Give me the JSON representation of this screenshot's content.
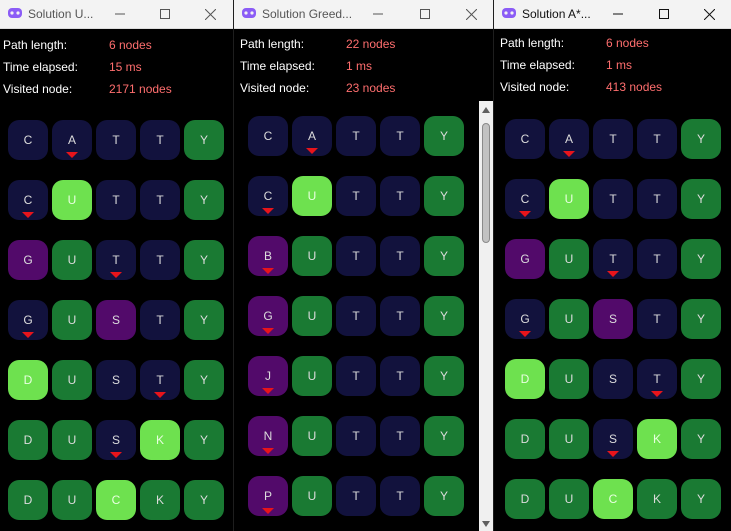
{
  "colors": {
    "navy": "#12123d",
    "green": "#1a7a33",
    "lime": "#6ee14f",
    "purple": "#520a6a",
    "marker": "#e8141b",
    "stat_value": "#ff6e6e"
  },
  "windows": [
    {
      "title": "Solution U...",
      "controls": {
        "minimize": "—",
        "maximize": "☐",
        "close": "✕"
      },
      "stats": [
        {
          "label": "Path length:",
          "value": "6 nodes"
        },
        {
          "label": "Time elapsed:",
          "value": "15 ms"
        },
        {
          "label": "Visited node:",
          "value": "2171 nodes"
        }
      ],
      "rows": [
        [
          {
            "l": "C",
            "c": "navy"
          },
          {
            "l": "A",
            "c": "navy",
            "m": true
          },
          {
            "l": "T",
            "c": "navy"
          },
          {
            "l": "T",
            "c": "navy"
          },
          {
            "l": "Y",
            "c": "green"
          }
        ],
        [
          {
            "l": "C",
            "c": "navy",
            "m": true
          },
          {
            "l": "U",
            "c": "lime"
          },
          {
            "l": "T",
            "c": "navy"
          },
          {
            "l": "T",
            "c": "navy"
          },
          {
            "l": "Y",
            "c": "green"
          }
        ],
        [
          {
            "l": "G",
            "c": "purple"
          },
          {
            "l": "U",
            "c": "green"
          },
          {
            "l": "T",
            "c": "navy",
            "m": true
          },
          {
            "l": "T",
            "c": "navy"
          },
          {
            "l": "Y",
            "c": "green"
          }
        ],
        [
          {
            "l": "G",
            "c": "navy",
            "m": true
          },
          {
            "l": "U",
            "c": "green"
          },
          {
            "l": "S",
            "c": "purple"
          },
          {
            "l": "T",
            "c": "navy"
          },
          {
            "l": "Y",
            "c": "green"
          }
        ],
        [
          {
            "l": "D",
            "c": "lime"
          },
          {
            "l": "U",
            "c": "green"
          },
          {
            "l": "S",
            "c": "navy"
          },
          {
            "l": "T",
            "c": "navy",
            "m": true
          },
          {
            "l": "Y",
            "c": "green"
          }
        ],
        [
          {
            "l": "D",
            "c": "green"
          },
          {
            "l": "U",
            "c": "green"
          },
          {
            "l": "S",
            "c": "navy",
            "m": true
          },
          {
            "l": "K",
            "c": "lime"
          },
          {
            "l": "Y",
            "c": "green"
          }
        ],
        [
          {
            "l": "D",
            "c": "green"
          },
          {
            "l": "U",
            "c": "green"
          },
          {
            "l": "C",
            "c": "lime"
          },
          {
            "l": "K",
            "c": "green"
          },
          {
            "l": "Y",
            "c": "green"
          }
        ]
      ]
    },
    {
      "title": "Solution Greed...",
      "controls": {
        "minimize": "—",
        "maximize": "☐",
        "close": "✕"
      },
      "stats": [
        {
          "label": "Path length:",
          "value": "22 nodes"
        },
        {
          "label": "Time elapsed:",
          "value": "1 ms"
        },
        {
          "label": "Visited node:",
          "value": "23 nodes"
        }
      ],
      "rows": [
        [
          {
            "l": "C",
            "c": "navy"
          },
          {
            "l": "A",
            "c": "navy",
            "m": true
          },
          {
            "l": "T",
            "c": "navy"
          },
          {
            "l": "T",
            "c": "navy"
          },
          {
            "l": "Y",
            "c": "green"
          }
        ],
        [
          {
            "l": "C",
            "c": "navy",
            "m": true
          },
          {
            "l": "U",
            "c": "lime"
          },
          {
            "l": "T",
            "c": "navy"
          },
          {
            "l": "T",
            "c": "navy"
          },
          {
            "l": "Y",
            "c": "green"
          }
        ],
        [
          {
            "l": "B",
            "c": "purple",
            "m": true
          },
          {
            "l": "U",
            "c": "green"
          },
          {
            "l": "T",
            "c": "navy"
          },
          {
            "l": "T",
            "c": "navy"
          },
          {
            "l": "Y",
            "c": "green"
          }
        ],
        [
          {
            "l": "G",
            "c": "purple",
            "m": true
          },
          {
            "l": "U",
            "c": "green"
          },
          {
            "l": "T",
            "c": "navy"
          },
          {
            "l": "T",
            "c": "navy"
          },
          {
            "l": "Y",
            "c": "green"
          }
        ],
        [
          {
            "l": "J",
            "c": "purple",
            "m": true
          },
          {
            "l": "U",
            "c": "green"
          },
          {
            "l": "T",
            "c": "navy"
          },
          {
            "l": "T",
            "c": "navy"
          },
          {
            "l": "Y",
            "c": "green"
          }
        ],
        [
          {
            "l": "N",
            "c": "purple",
            "m": true
          },
          {
            "l": "U",
            "c": "green"
          },
          {
            "l": "T",
            "c": "navy"
          },
          {
            "l": "T",
            "c": "navy"
          },
          {
            "l": "Y",
            "c": "green"
          }
        ],
        [
          {
            "l": "P",
            "c": "purple",
            "m": true
          },
          {
            "l": "U",
            "c": "green"
          },
          {
            "l": "T",
            "c": "navy"
          },
          {
            "l": "T",
            "c": "navy"
          },
          {
            "l": "Y",
            "c": "green"
          }
        ]
      ]
    },
    {
      "title": "Solution A*...",
      "controls": {
        "minimize": "—",
        "maximize": "☐",
        "close": "✕"
      },
      "stats": [
        {
          "label": "Path length:",
          "value": "6 nodes"
        },
        {
          "label": "Time elapsed:",
          "value": "1 ms"
        },
        {
          "label": "Visited node:",
          "value": "413 nodes"
        }
      ],
      "rows": [
        [
          {
            "l": "C",
            "c": "navy"
          },
          {
            "l": "A",
            "c": "navy",
            "m": true
          },
          {
            "l": "T",
            "c": "navy"
          },
          {
            "l": "T",
            "c": "navy"
          },
          {
            "l": "Y",
            "c": "green"
          }
        ],
        [
          {
            "l": "C",
            "c": "navy",
            "m": true
          },
          {
            "l": "U",
            "c": "lime"
          },
          {
            "l": "T",
            "c": "navy"
          },
          {
            "l": "T",
            "c": "navy"
          },
          {
            "l": "Y",
            "c": "green"
          }
        ],
        [
          {
            "l": "G",
            "c": "purple"
          },
          {
            "l": "U",
            "c": "green"
          },
          {
            "l": "T",
            "c": "navy",
            "m": true
          },
          {
            "l": "T",
            "c": "navy"
          },
          {
            "l": "Y",
            "c": "green"
          }
        ],
        [
          {
            "l": "G",
            "c": "navy",
            "m": true
          },
          {
            "l": "U",
            "c": "green"
          },
          {
            "l": "S",
            "c": "purple"
          },
          {
            "l": "T",
            "c": "navy"
          },
          {
            "l": "Y",
            "c": "green"
          }
        ],
        [
          {
            "l": "D",
            "c": "lime"
          },
          {
            "l": "U",
            "c": "green"
          },
          {
            "l": "S",
            "c": "navy"
          },
          {
            "l": "T",
            "c": "navy",
            "m": true
          },
          {
            "l": "Y",
            "c": "green"
          }
        ],
        [
          {
            "l": "D",
            "c": "green"
          },
          {
            "l": "U",
            "c": "green"
          },
          {
            "l": "S",
            "c": "navy",
            "m": true
          },
          {
            "l": "K",
            "c": "lime"
          },
          {
            "l": "Y",
            "c": "green"
          }
        ],
        [
          {
            "l": "D",
            "c": "green"
          },
          {
            "l": "U",
            "c": "green"
          },
          {
            "l": "C",
            "c": "lime"
          },
          {
            "l": "K",
            "c": "green"
          },
          {
            "l": "Y",
            "c": "green"
          }
        ]
      ]
    }
  ]
}
